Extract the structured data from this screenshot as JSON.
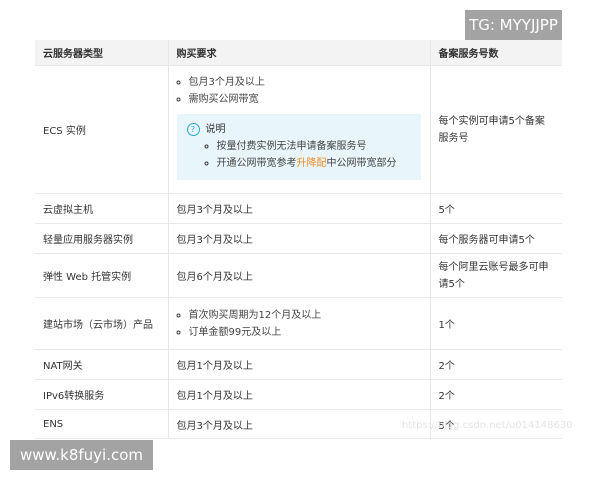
{
  "watermarks": {
    "top": "TG: MYYJJPP",
    "bottom": "www.k8fuyi.com",
    "csdn": "https://blog.csdn.net/u014148630"
  },
  "headers": [
    "云服务器类型",
    "购买要求",
    "备案服务号数"
  ],
  "ecs": {
    "type": "ECS 实例",
    "reqs": [
      "包月3个月及以上",
      "需购买公网带宽"
    ],
    "note_title": "说明",
    "note_items": [
      "按量付费实例无法申请备案服务号"
    ],
    "note_link_pre": "开通公网带宽参考",
    "note_link": "升降配",
    "note_link_post": "中公网带宽部分",
    "count": "每个实例可申请5个备案服务号"
  },
  "rows": [
    {
      "type": "云虚拟主机",
      "req": "包月3个月及以上",
      "count": "5个"
    },
    {
      "type": "轻量应用服务器实例",
      "req": "包月3个月及以上",
      "count": "每个服务器可申请5个"
    },
    {
      "type": "弹性 Web 托管实例",
      "req": "包月6个月及以上",
      "count": "每个阿里云账号最多可申请5个"
    }
  ],
  "market": {
    "type": "建站市场（云市场）产品",
    "reqs": [
      "首次购买周期为12个月及以上",
      "订单金额99元及以上"
    ],
    "count": "1个"
  },
  "rows2": [
    {
      "type": "NAT网关",
      "req": "包月1个月及以上",
      "count": "2个"
    },
    {
      "type": "IPv6转换服务",
      "req": "包月1个月及以上",
      "count": "2个"
    },
    {
      "type": "ENS",
      "req": "包月3个月及以上",
      "count": "5个"
    }
  ],
  "colors": {
    "accent": "#f08a24",
    "note_bg": "#e8f6fc",
    "icon": "#29a9d6"
  }
}
